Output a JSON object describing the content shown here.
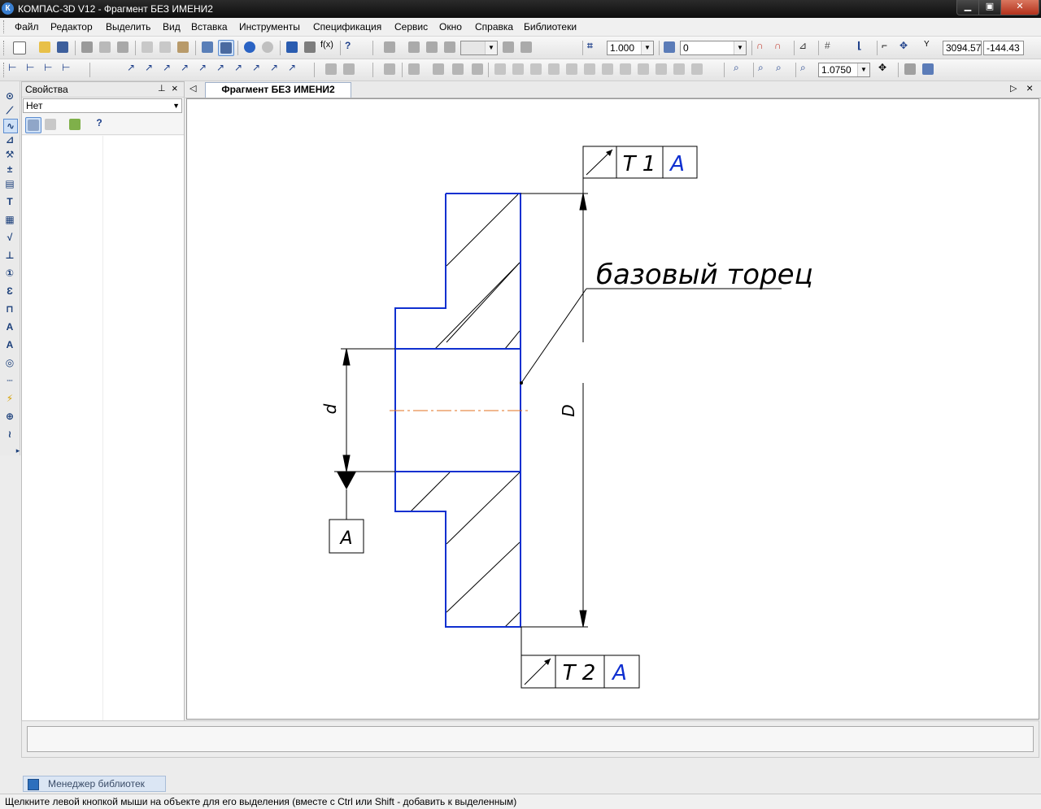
{
  "window": {
    "title": "КОМПАС-3D V12 - Фрагмент БЕЗ ИМЕНИ2"
  },
  "menu": [
    "Файл",
    "Редактор",
    "Выделить",
    "Вид",
    "Вставка",
    "Инструменты",
    "Спецификация",
    "Сервис",
    "Окно",
    "Справка",
    "Библиотеки"
  ],
  "toolbar": {
    "scale": "1.000",
    "layer": "0",
    "coord_x": "3094.57",
    "coord_y": "-144.43",
    "zoom": "1.0750"
  },
  "properties": {
    "title": "Свойства",
    "selector": "Нет"
  },
  "document": {
    "tab": "Фрагмент БЕЗ ИМЕНИ2"
  },
  "drawing": {
    "tol_top": {
      "tol": "T 1",
      "base": "A"
    },
    "tol_bottom": {
      "tol": "T 2",
      "base": "A"
    },
    "base_label": "A",
    "dim_small": "d",
    "dim_large": "D",
    "leader_text": "базовый торец"
  },
  "library_tab": "Менеджер библиотек",
  "status": "Щелкните левой кнопкой мыши на объекте для его выделения (вместе с Ctrl или Shift - добавить к выделенным)"
}
